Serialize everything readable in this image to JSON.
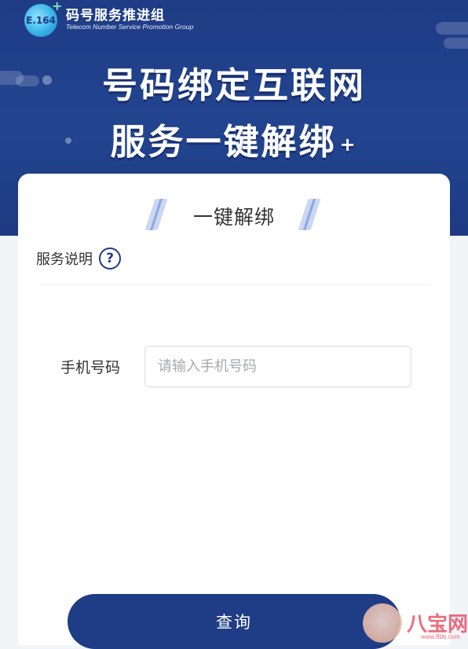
{
  "header": {
    "logo_text": "E.164",
    "logo_plus": "+",
    "org_name": "码号服务推进组",
    "org_subtitle": "Telecom Number Service  Promotion Group",
    "title_line1": "号码绑定互联网",
    "title_line2": "服务一键解绑",
    "title_plus": "+",
    "colors": {
      "primary": "#1f3c86",
      "logo_accent": "#39b3e8"
    }
  },
  "card": {
    "title": "一键解绑",
    "service_label": "服务说明",
    "help_icon": "?",
    "phone_label": "手机号码",
    "phone_value": "",
    "phone_placeholder": "请输入手机号码",
    "query_button": "查询"
  },
  "watermark": {
    "text": "八宝网",
    "url": "www.8bb.com"
  }
}
